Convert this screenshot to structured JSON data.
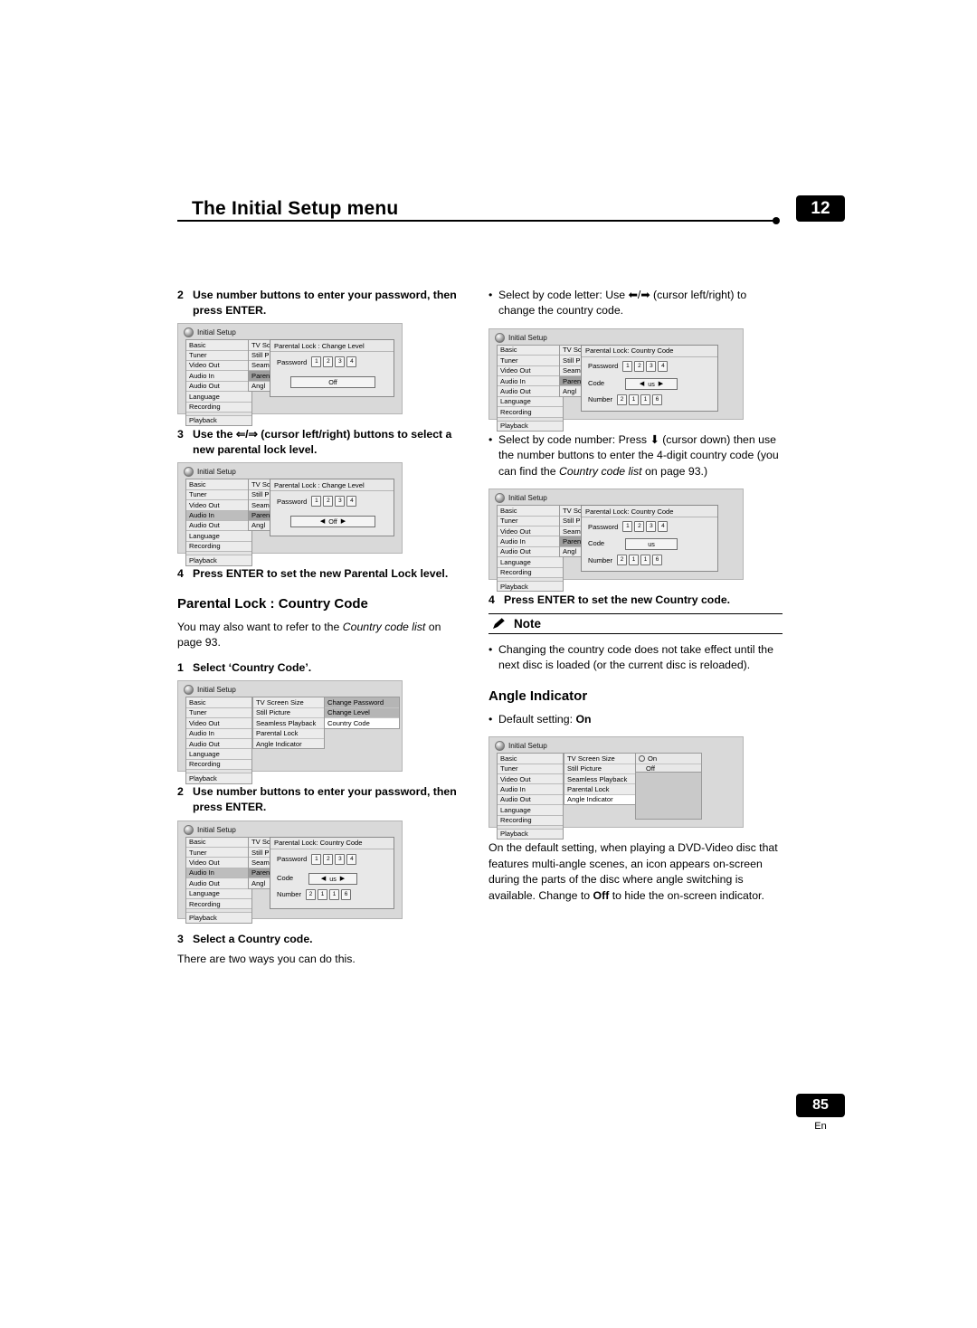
{
  "header": {
    "title": "The Initial Setup menu",
    "chapter": "12"
  },
  "footer": {
    "page_number": "85",
    "language": "En"
  },
  "left_column": {
    "step2a": {
      "num": "2",
      "text": "Use number buttons to enter your password, then press ENTER."
    },
    "step3": {
      "num": "3",
      "text": "Use the ⇐/⇒ (cursor left/right) buttons to select a new parental lock level."
    },
    "step4": {
      "num": "4",
      "text": "Press ENTER to set the new Parental Lock level."
    },
    "section_title": "Parental Lock : Country Code",
    "para1_a": "You may also want to refer to the ",
    "para1_ital": "Country code list",
    "para1_b": " on page 93.",
    "step1": {
      "num": "1",
      "text": "Select ‘Country Code’."
    },
    "step2b": {
      "num": "2",
      "text": "Use number buttons to enter your password, then press ENTER."
    },
    "step3b": {
      "num": "3",
      "text": "Select a Country code."
    },
    "para2": "There are two ways you can do this."
  },
  "right_column": {
    "bullet1_a": "Select by code letter: Use ",
    "bullet1_b": " (cursor left/right) to change the country code.",
    "bullet2_a": "Select by code number: Press ",
    "bullet2_b": " (cursor down) then use the number buttons to enter the 4-digit country code (you can find the ",
    "bullet2_ital": "Country code list",
    "bullet2_c": " on page 93.)",
    "step4": {
      "num": "4",
      "text": "Press ENTER to set the new Country code."
    },
    "note_label": "Note",
    "note_bullet": "Changing the country code does not take effect until the next disc is loaded (or the current disc is reloaded).",
    "angle_title": "Angle Indicator",
    "angle_default_a": "Default setting: ",
    "angle_default_b": "On",
    "angle_para_a": "On the default setting, when playing a DVD-Video disc that features multi-angle scenes, an icon appears on-screen during the parts of the disc where angle switching is available. Change to ",
    "angle_para_bold": "Off",
    "angle_para_b": " to hide the on-screen indicator."
  },
  "osd": {
    "window_title": "Initial Setup",
    "main_menu": [
      "Basic",
      "Tuner",
      "Video Out",
      "Audio In",
      "Audio Out",
      "Language",
      "Recording",
      "Playback"
    ],
    "sub_menu": [
      "TV Screen Size",
      "Still Picture",
      "Seamless Playback",
      "Parental Lock",
      "Angle Indicator"
    ],
    "sub_menu_short": [
      "TV Sc",
      "Still P",
      "Seam",
      "Paren",
      "Angl"
    ],
    "third_menu": [
      "Change Password",
      "Change Level",
      "Country Code"
    ],
    "angle_options": [
      "On",
      "Off"
    ],
    "dialog_change_level": "Parental Lock : Change Level",
    "dialog_country_code": "Parental Lock: Country Code",
    "label_password": "Password",
    "label_code": "Code",
    "label_number": "Number",
    "password_digits": [
      "1",
      "2",
      "3",
      "4"
    ],
    "code_value": "us",
    "number_digits": [
      "2",
      "1",
      "1",
      "6"
    ],
    "level_value": "Off",
    "arrow_left": "◀",
    "arrow_right": "▶"
  }
}
